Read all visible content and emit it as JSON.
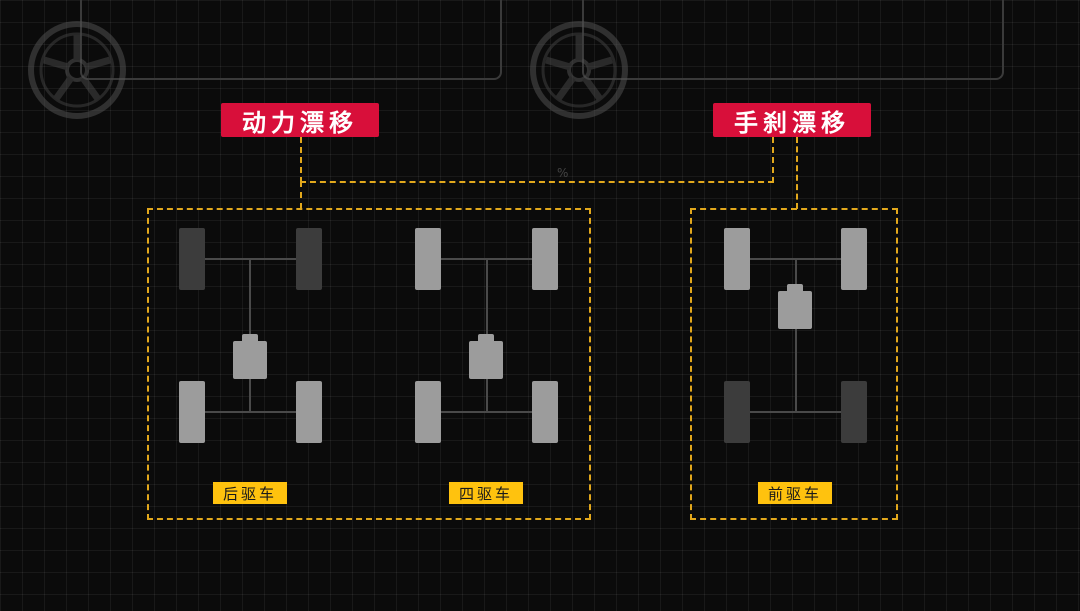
{
  "top_labels": {
    "power_drift": "动力漂移",
    "handbrake_drift": "手刹漂移"
  },
  "drivetrains": {
    "rwd": "后驱车",
    "awd": "四驱车",
    "fwd": "前驱车"
  },
  "decor": {
    "percent_mark": "%"
  },
  "colors": {
    "title_red": "#d80f3a",
    "accent_yellow": "#ffc20e",
    "dash_orange": "#e2a81c"
  }
}
